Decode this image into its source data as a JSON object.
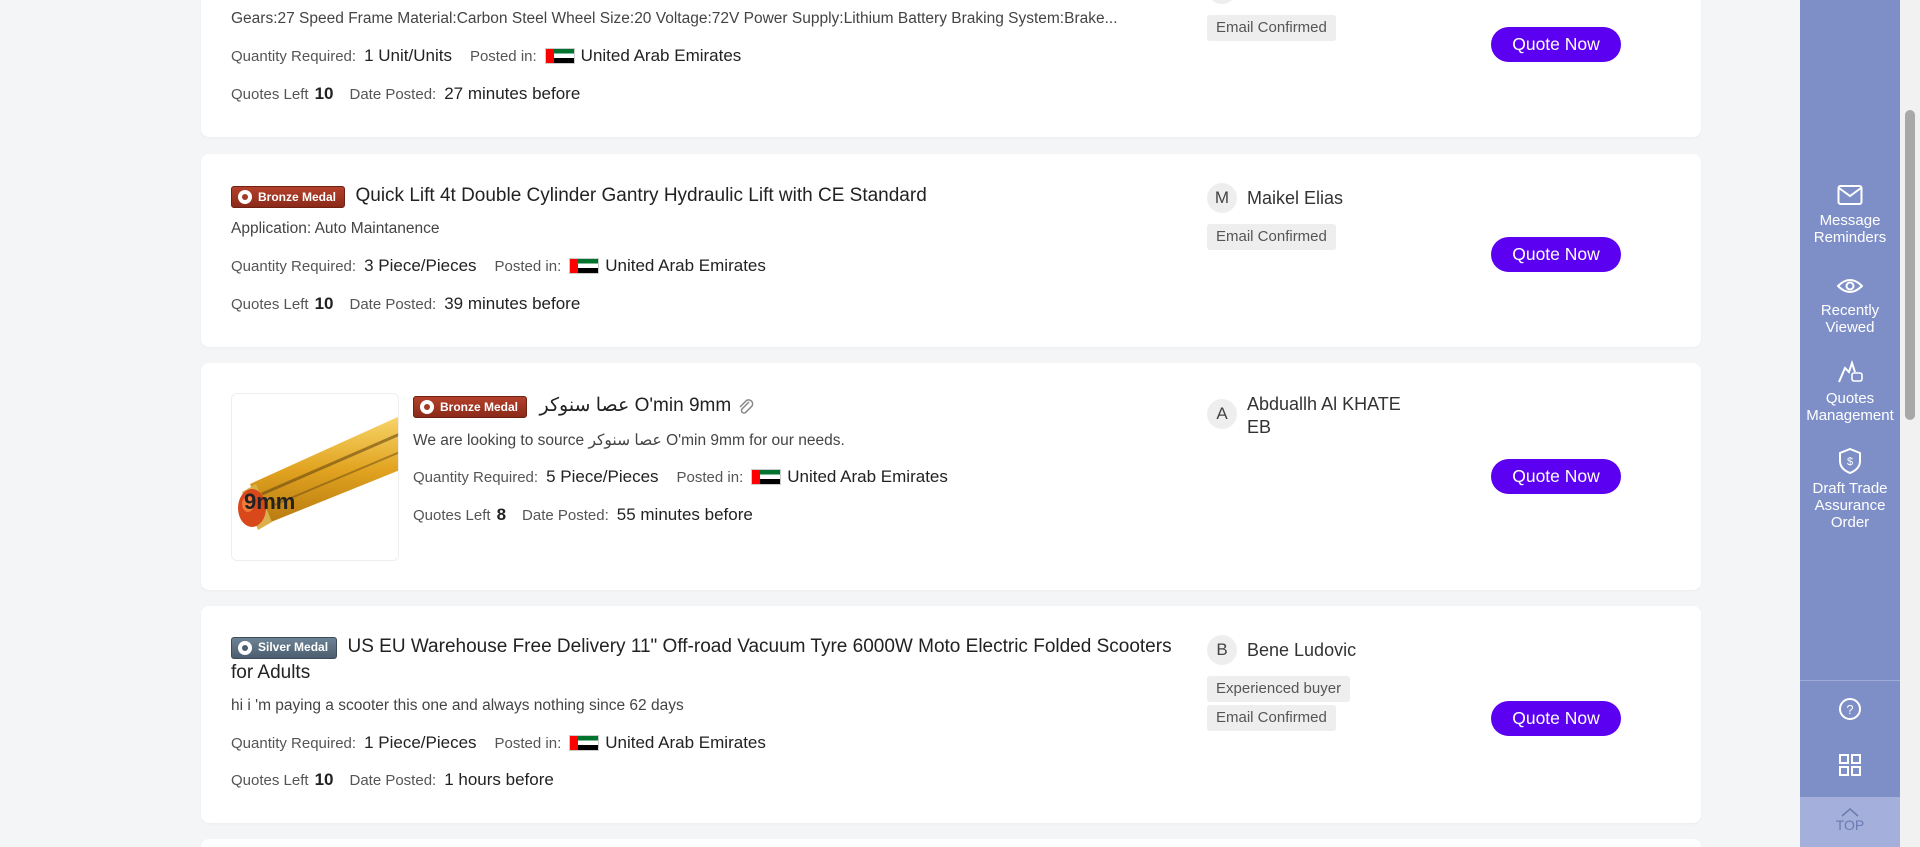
{
  "cards": [
    {
      "description": "Gears:27 Speed Frame Material:Carbon Steel Wheel Size:20 Voltage:72V Power Supply:Lithium Battery Braking System:Brake...",
      "quantity_label": "Quantity Required:",
      "quantity": "1 Unit/Units",
      "posted_label": "Posted in:",
      "country": "United Arab Emirates",
      "quotes_left_label": "Quotes Left",
      "quotes_left": "10",
      "date_label": "Date Posted:",
      "date": "27 minutes before",
      "tags": [
        "Email Confirmed"
      ],
      "quote_button": "Quote Now"
    },
    {
      "medal": "Bronze Medal",
      "title": "Quick Lift 4t Double Cylinder Gantry Hydraulic Lift with CE Standard",
      "description": "Application: Auto Maintanence",
      "quantity_label": "Quantity Required:",
      "quantity": "3 Piece/Pieces",
      "posted_label": "Posted in:",
      "country": "United Arab Emirates",
      "quotes_left_label": "Quotes Left",
      "quotes_left": "10",
      "date_label": "Date Posted:",
      "date": "39 minutes before",
      "buyer_initial": "M",
      "buyer_name": "Maikel Elias",
      "tags": [
        "Email Confirmed"
      ],
      "quote_button": "Quote Now"
    },
    {
      "medal": "Bronze Medal",
      "title": "عصا سنوكر O'min 9mm",
      "thumb_text": "9mm",
      "description": "We are looking to source عصا سنوكر O'min 9mm for our needs.",
      "quantity_label": "Quantity Required:",
      "quantity": "5 Piece/Pieces",
      "posted_label": "Posted in:",
      "country": "United Arab Emirates",
      "quotes_left_label": "Quotes Left",
      "quotes_left": "8",
      "date_label": "Date Posted:",
      "date": "55 minutes before",
      "buyer_initial": "A",
      "buyer_name": "Abduallh Al KHATE EB",
      "quote_button": "Quote Now"
    },
    {
      "medal": "Silver Medal",
      "title": "US EU Warehouse Free Delivery 11\" Off-road Vacuum Tyre 6000W Moto Electric Folded Scooters for Adults",
      "description": "hi i 'm paying a scooter this one and always nothing since 62 days",
      "quantity_label": "Quantity Required:",
      "quantity": "1 Piece/Pieces",
      "posted_label": "Posted in:",
      "country": "United Arab Emirates",
      "quotes_left_label": "Quotes Left",
      "quotes_left": "10",
      "date_label": "Date Posted:",
      "date": "1 hours before",
      "buyer_initial": "B",
      "buyer_name": "Bene Ludovic",
      "tags": [
        "Experienced buyer",
        "Email Confirmed"
      ],
      "quote_button": "Quote Now"
    }
  ],
  "sidebar": {
    "items": [
      {
        "label": "Message Reminders",
        "icon": "envelope-icon"
      },
      {
        "label": "Recently Viewed",
        "icon": "eye-icon"
      },
      {
        "label": "Quotes Management",
        "icon": "quote-hand-icon"
      },
      {
        "label": "Draft Trade Assurance Order",
        "icon": "shield-dollar-icon"
      }
    ],
    "help_icon": "question-circle-icon",
    "qr_icon": "qr-code-icon",
    "top_label": "TOP"
  },
  "colors": {
    "accent": "#5b00f0",
    "sidebar_bg": "#7e8fc8",
    "bronze": "#a23a25",
    "silver": "#5b6e80"
  }
}
